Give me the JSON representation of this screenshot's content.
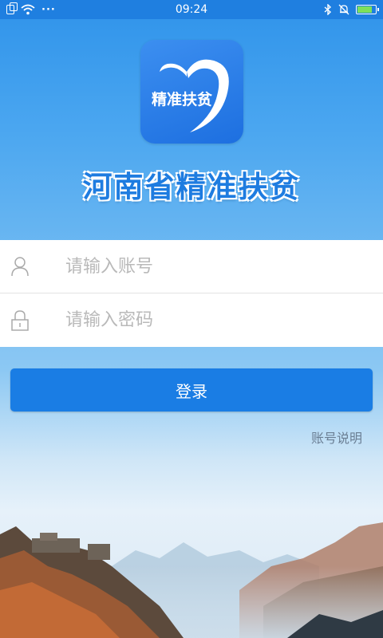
{
  "status_bar": {
    "time": "09:24",
    "dots": "···",
    "battery_level": 0.85
  },
  "logo": {
    "text": "精准扶贫"
  },
  "app_title": "河南省精准扶贫",
  "form": {
    "account": {
      "placeholder": "请输入账号",
      "value": ""
    },
    "password": {
      "placeholder": "请输入密码",
      "value": ""
    }
  },
  "login_button": {
    "label": "登录"
  },
  "account_info_link": {
    "label": "账号说明"
  },
  "colors": {
    "primary": "#1a7de4",
    "title": "#1e7ce0",
    "link": "#6b7f94",
    "placeholder": "#b9b9b9"
  }
}
